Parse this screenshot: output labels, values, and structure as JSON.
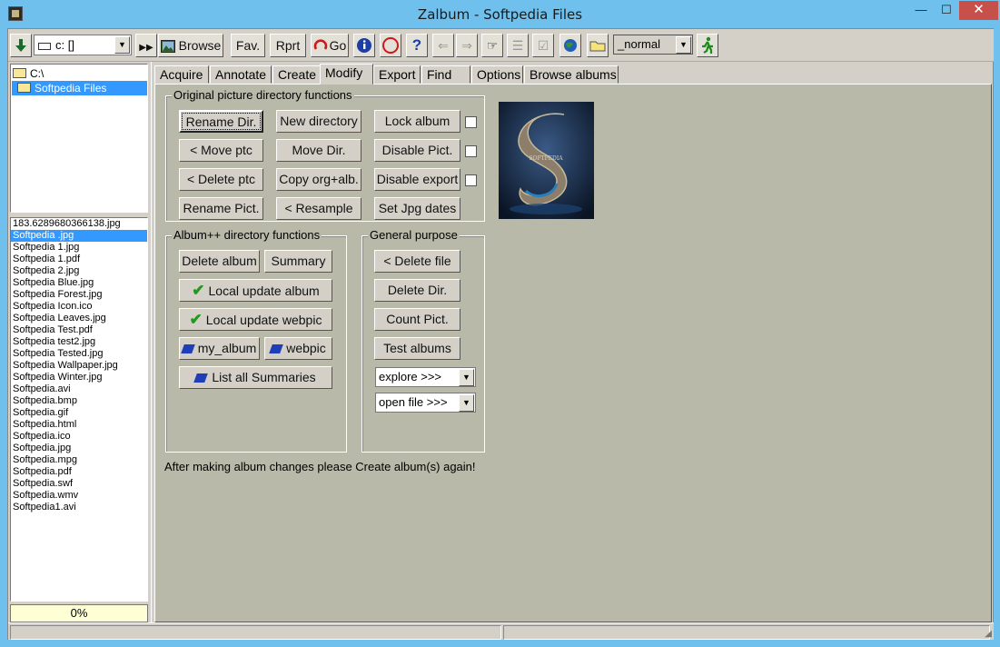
{
  "window": {
    "title": "Zalbum - Softpedia Files",
    "minimize": "—",
    "maximize": "☐",
    "close": "✕"
  },
  "toolbar": {
    "drive_value": "c: []",
    "browse_label": "Browse",
    "fav_label": "Fav.",
    "rprt_label": "Rprt",
    "go_label": "Go",
    "mode_value": "_normal"
  },
  "tree": {
    "items": [
      "C:\\",
      "Softpedia Files"
    ]
  },
  "files": [
    "183.6289680366138.jpg",
    "Softpedia .jpg",
    "Softpedia 1.jpg",
    "Softpedia 1.pdf",
    "Softpedia 2.jpg",
    "Softpedia Blue.jpg",
    "Softpedia Forest.jpg",
    "Softpedia Icon.ico",
    "Softpedia Leaves.jpg",
    "Softpedia Test.pdf",
    "Softpedia test2.jpg",
    "Softpedia Tested.jpg",
    "Softpedia Wallpaper.jpg",
    "Softpedia Winter.jpg",
    "Softpedia.avi",
    "Softpedia.bmp",
    "Softpedia.gif",
    "Softpedia.html",
    "Softpedia.ico",
    "Softpedia.jpg",
    "Softpedia.mpg",
    "Softpedia.pdf",
    "Softpedia.swf",
    "Softpedia.wmv",
    "Softpedia1.avi"
  ],
  "selected_file": "Softpedia .jpg",
  "progress": "0%",
  "tabs": [
    "Acquire",
    "Annotate",
    "Create",
    "Modify",
    "Export",
    "Find",
    "Options",
    "Browse albums"
  ],
  "active_tab": "Modify",
  "original_group": {
    "label": "Original picture directory functions",
    "rename_dir": "Rename Dir.",
    "new_directory": "New directory",
    "lock_album": "Lock album",
    "move_ptc": "< Move ptc",
    "move_dir": "Move Dir.",
    "disable_pict": "Disable Pict.",
    "delete_ptc": "< Delete ptc",
    "copy_org": "Copy org+alb.",
    "disable_export": "Disable export",
    "rename_pict": "Rename Pict.",
    "resample": "< Resample",
    "set_jpg_dates": "Set Jpg dates"
  },
  "albumpp_group": {
    "label": "Album++ directory functions",
    "delete_album": "Delete album",
    "summary": "Summary",
    "local_update_album": "Local update album",
    "local_update_webpic": "Local update webpic",
    "my_album": "my_album",
    "webpic": "webpic",
    "list_all_summaries": "List all Summaries"
  },
  "general_group": {
    "label": "General purpose",
    "delete_file": "< Delete file",
    "delete_dir": "Delete Dir.",
    "count_pict": "Count Pict.",
    "test_albums": "Test albums",
    "explore": "explore >>>",
    "open_file": "open file >>>"
  },
  "note": "After making album changes please Create album(s) again!",
  "preview_caption": "SOFTPEDIA",
  "colors": {
    "panel": "#b9b9a9",
    "selection": "#3399ff",
    "window_frame": "#6fc0ec",
    "close_button": "#c7504a"
  }
}
